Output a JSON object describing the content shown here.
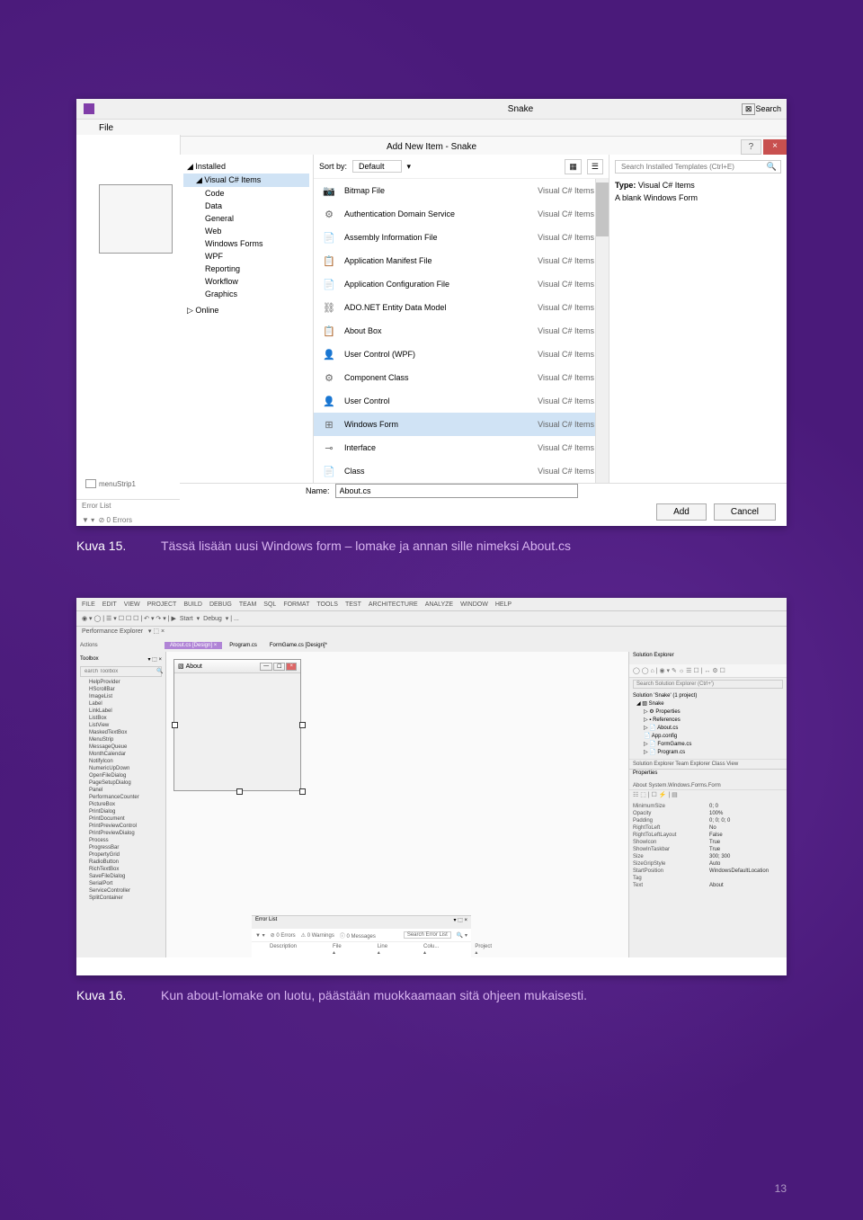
{
  "page_number": "13",
  "fig15": {
    "window_title": "Snake",
    "file_menu": "File",
    "search": "Search",
    "dialog_title": "Add New Item - Snake",
    "help": "?",
    "close": "×",
    "tree": {
      "installed": "Installed",
      "vcs_items": "Visual C# Items",
      "subs": [
        "Code",
        "Data",
        "General",
        "Web",
        "Windows Forms",
        "WPF",
        "Reporting",
        "Workflow",
        "Graphics"
      ],
      "online": "Online"
    },
    "sort_label": "Sort by:",
    "sort_value": "Default",
    "search_placeholder": "Search Installed Templates (Ctrl+E)",
    "type_label": "Type:",
    "type_value": "Visual C# Items",
    "type_desc": "A blank Windows Form",
    "items": [
      {
        "name": "Class",
        "cat": "Visual C# Items"
      },
      {
        "name": "Interface",
        "cat": "Visual C# Items"
      },
      {
        "name": "Windows Form",
        "cat": "Visual C# Items",
        "sel": true
      },
      {
        "name": "User Control",
        "cat": "Visual C# Items"
      },
      {
        "name": "Component Class",
        "cat": "Visual C# Items"
      },
      {
        "name": "User Control (WPF)",
        "cat": "Visual C# Items"
      },
      {
        "name": "About Box",
        "cat": "Visual C# Items"
      },
      {
        "name": "ADO.NET Entity Data Model",
        "cat": "Visual C# Items"
      },
      {
        "name": "Application Configuration File",
        "cat": "Visual C# Items"
      },
      {
        "name": "Application Manifest File",
        "cat": "Visual C# Items"
      },
      {
        "name": "Assembly Information File",
        "cat": "Visual C# Items"
      },
      {
        "name": "Authentication Domain Service",
        "cat": "Visual C# Items"
      },
      {
        "name": "Bitmap File",
        "cat": "Visual C# Items"
      }
    ],
    "name_label": "Name:",
    "name_value": "About.cs",
    "add": "Add",
    "cancel": "Cancel",
    "menustrip": "menuStrip1",
    "errorlist": "Error List",
    "status": "0 Errors"
  },
  "cap15": {
    "n": "Kuva 15.",
    "t": "Tässä lisään uusi Windows form – lomake ja annan sille nimeksi About.cs"
  },
  "fig16": {
    "menus": [
      "FILE",
      "EDIT",
      "VIEW",
      "PROJECT",
      "BUILD",
      "DEBUG",
      "TEAM",
      "SQL",
      "FORMAT",
      "TOOLS",
      "TEST",
      "ARCHITECTURE",
      "ANALYZE",
      "WINDOW",
      "HELP"
    ],
    "start": "Start",
    "debug": "Debug",
    "tabs": [
      {
        "label": "About.cs [Design]",
        "act": true
      },
      {
        "label": "Program.cs"
      },
      {
        "label": "FormGame.cs [Design]*"
      }
    ],
    "perf": "Performance Explorer",
    "actions": "Actions",
    "toolbox_hdr": "Toolbox",
    "toolbox_search": "earch Toolbox",
    "toolbox": [
      "HelpProvider",
      "HScrollBar",
      "ImageList",
      "Label",
      "LinkLabel",
      "ListBox",
      "ListView",
      "MaskedTextBox",
      "MenuStrip",
      "MessageQueue",
      "MonthCalendar",
      "NotifyIcon",
      "NumericUpDown",
      "OpenFileDialog",
      "PageSetupDialog",
      "Panel",
      "PerformanceCounter",
      "PictureBox",
      "PrintDialog",
      "PrintDocument",
      "PrintPreviewControl",
      "PrintPreviewDialog",
      "Process",
      "ProgressBar",
      "PropertyGrid",
      "RadioButton",
      "RichTextBox",
      "SaveFileDialog",
      "SerialPort",
      "ServiceController",
      "SplitContainer"
    ],
    "about_title": "About",
    "err_hdr": "Error List",
    "err_tb": {
      "errors": "0 Errors",
      "warnings": "0 Warnings",
      "messages": "0 Messages",
      "search": "Search Error List"
    },
    "err_cols": [
      "Description",
      "File",
      "Line",
      "Colu...",
      "Project"
    ],
    "se_hdr": "Solution Explorer",
    "se_search": "Search Solution Explorer (Ctrl+')",
    "se_sol": "Solution 'Snake' (1 project)",
    "se_tree": [
      "Snake",
      "Properties",
      "References",
      "About.cs",
      "App.config",
      "FormGame.cs",
      "Program.cs"
    ],
    "se_tabs": "Solution Explorer  Team Explorer  Class View",
    "props_hdr": "Properties",
    "props_sub": "About  System.Windows.Forms.Form",
    "props": [
      {
        "k": "MinimumSize",
        "v": "0; 0"
      },
      {
        "k": "Opacity",
        "v": "100%"
      },
      {
        "k": "Padding",
        "v": "0; 0; 0; 0"
      },
      {
        "k": "RightToLeft",
        "v": "No"
      },
      {
        "k": "RightToLeftLayout",
        "v": "False"
      },
      {
        "k": "ShowIcon",
        "v": "True"
      },
      {
        "k": "ShowInTaskbar",
        "v": "True"
      },
      {
        "k": "Size",
        "v": "300; 300"
      },
      {
        "k": "SizeGripStyle",
        "v": "Auto"
      },
      {
        "k": "StartPosition",
        "v": "WindowsDefaultLocation"
      },
      {
        "k": "Tag",
        "v": ""
      },
      {
        "k": "Text",
        "v": "About"
      }
    ]
  },
  "cap16": {
    "n": "Kuva 16.",
    "t": "Kun about-lomake on luotu, päästään muokkaamaan sitä ohjeen mukaisesti."
  }
}
